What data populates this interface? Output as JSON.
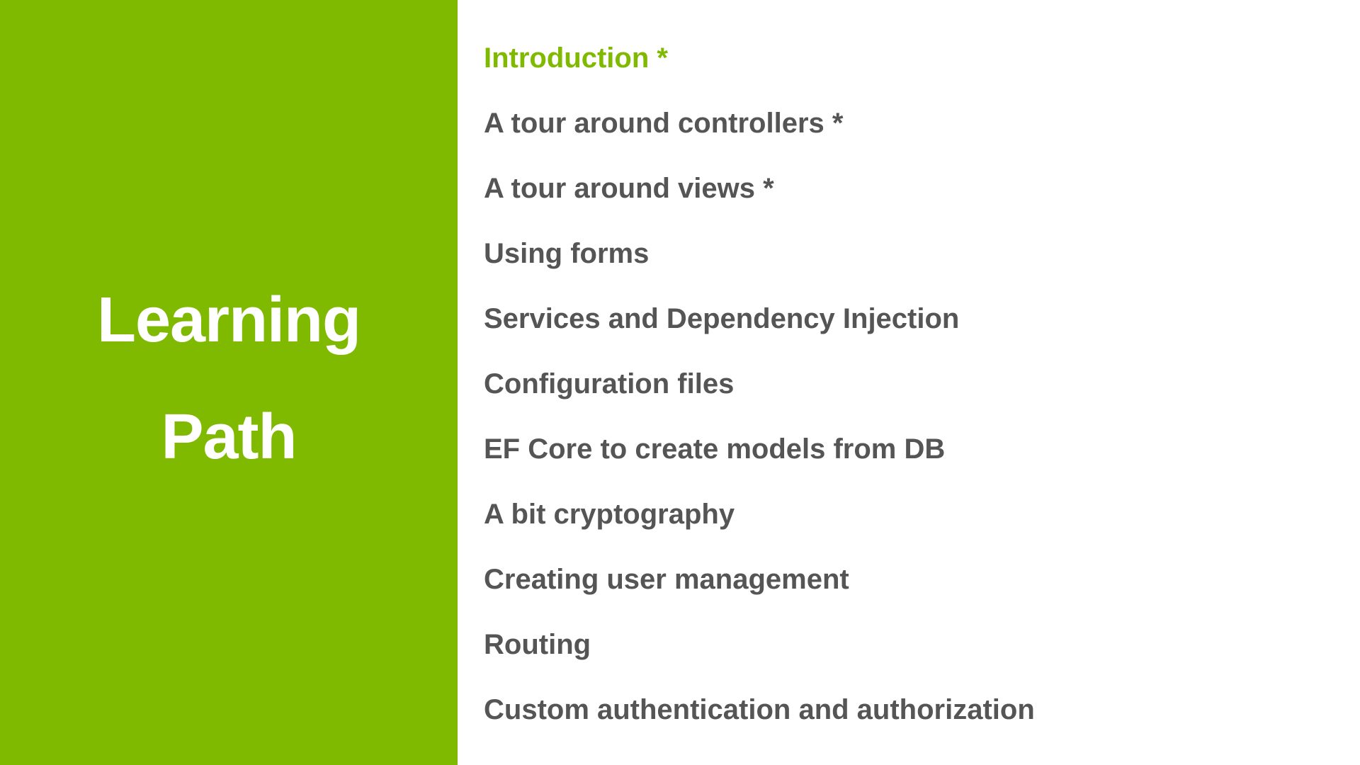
{
  "left_panel": {
    "title_line1": "Learning",
    "title_line2": "Path",
    "background_color": "#7fba00"
  },
  "topics": [
    {
      "label": "Introduction  *",
      "active": true
    },
    {
      "label": "A tour around controllers  *",
      "active": false
    },
    {
      "label": "A tour around views  *",
      "active": false
    },
    {
      "label": "Using forms",
      "active": false
    },
    {
      "label": "Services and Dependency Injection",
      "active": false
    },
    {
      "label": "Configuration files",
      "active": false
    },
    {
      "label": "EF Core to create models from DB",
      "active": false
    },
    {
      "label": "A bit cryptography",
      "active": false
    },
    {
      "label": "Creating user management",
      "active": false
    },
    {
      "label": "Routing",
      "active": false
    },
    {
      "label": "Custom authentication and authorization",
      "active": false
    }
  ],
  "colors": {
    "accent": "#7fba00",
    "text": "#555555",
    "title_text": "#ffffff"
  }
}
